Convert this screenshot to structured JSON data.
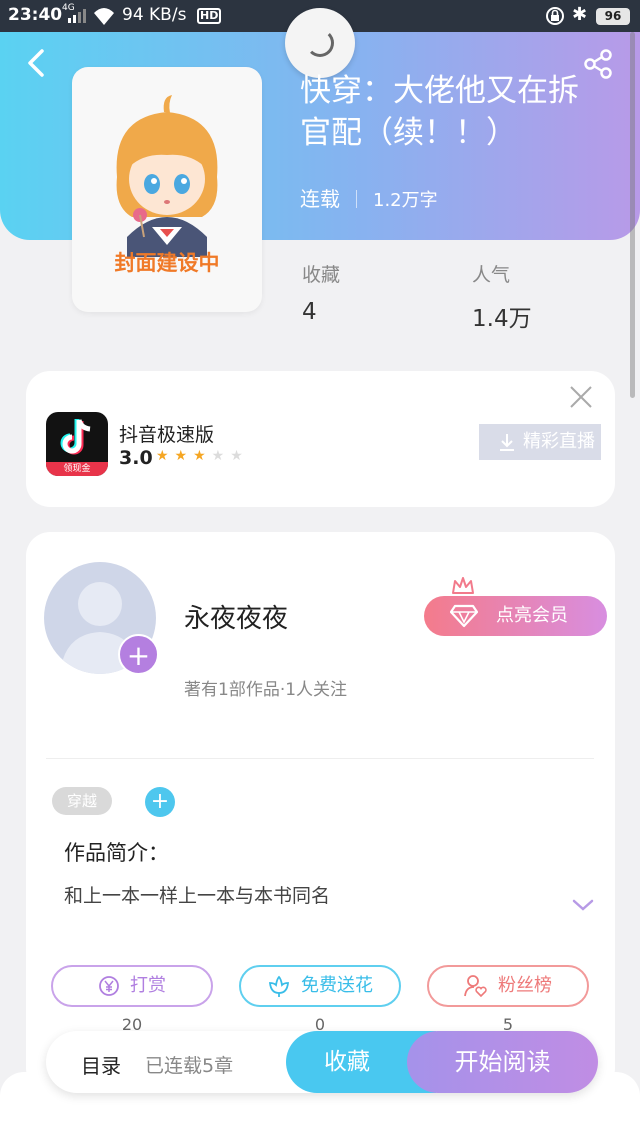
{
  "status_bar": {
    "time": "23:40",
    "network": "4G",
    "speed": "94 KB/s",
    "hd": "HD",
    "battery": "96"
  },
  "header": {
    "back_icon": "chevron-left-icon",
    "share_icon": "share-icon",
    "loading_icon": "loading-spinner-icon"
  },
  "book": {
    "cover_placeholder": "封面建设中",
    "title": "快穿：大佬他又在拆官配（续！！）",
    "status": "连载",
    "word_count": "1.2万字",
    "stats": [
      {
        "label": "收藏",
        "value": "4"
      },
      {
        "label": "人气",
        "value": "1.4万"
      }
    ]
  },
  "ad": {
    "app_name": "抖音极速版",
    "rating": "3.0",
    "stars_filled": 3,
    "stars_total": 5,
    "icon_badge": "领现金",
    "action_label": "精彩直播",
    "close_icon": "close-icon"
  },
  "author": {
    "name": "永夜夜夜",
    "info": "著有1部作品·1人关注",
    "vip_label": "点亮会员"
  },
  "intro": {
    "tag": "穿越",
    "heading": "作品简介：",
    "text": "和上一本一样上一本与本书同名"
  },
  "actions": [
    {
      "label": "打赏",
      "count": "20"
    },
    {
      "label": "免费送花",
      "count": "0"
    },
    {
      "label": "粉丝榜",
      "count": "5"
    }
  ],
  "bottom_bar": {
    "toc_label": "目录",
    "toc_status": "已连载5章",
    "favorite_label": "收藏",
    "read_label": "开始阅读"
  },
  "colors": {
    "accent_blue": "#49c8f0",
    "accent_purple": "#b89ae8",
    "cover_text": "#f07a28"
  }
}
